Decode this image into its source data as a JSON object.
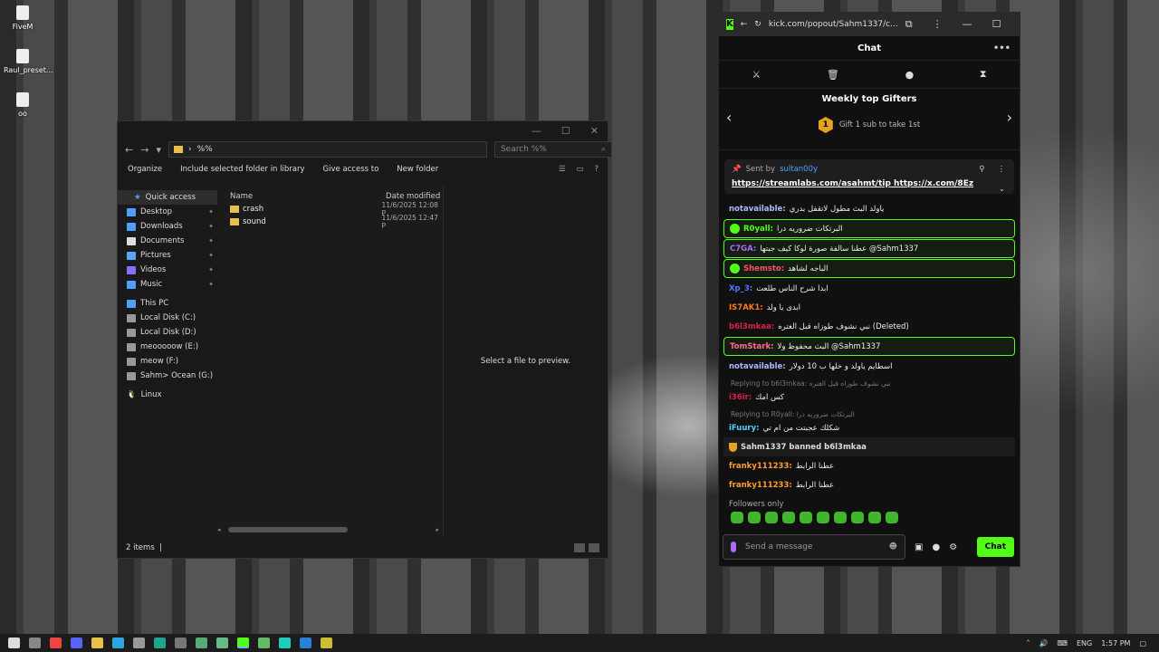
{
  "desktop": {
    "icons": [
      {
        "label": "FiveM"
      },
      {
        "label": "Raul_preset..."
      },
      {
        "label": "oo"
      }
    ]
  },
  "explorer": {
    "address": "%%",
    "search_placeholder": "Search %%",
    "toolbar": {
      "organize": "Organize",
      "include": "Include selected folder in library",
      "give_access": "Give access to",
      "new_folder": "New folder"
    },
    "nav": {
      "quick_access": "Quick access",
      "desktop": "Desktop",
      "downloads": "Downloads",
      "documents": "Documents",
      "pictures": "Pictures",
      "videos": "Videos",
      "music": "Music",
      "this_pc": "This PC",
      "c": "Local Disk (C:)",
      "d": "Local Disk (D:)",
      "e": "meooooow (E:)",
      "f": "meow (F:)",
      "g": "Sahm> Ocean (G:)",
      "linux": "Linux"
    },
    "columns": {
      "name": "Name",
      "date": "Date modified"
    },
    "files": [
      {
        "name": "crash",
        "date": "11/6/2025 12:08 P"
      },
      {
        "name": "sound",
        "date": "11/6/2025 12:47 P"
      }
    ],
    "preview": "Select a file to preview.",
    "status": "2 items"
  },
  "kick": {
    "url": "kick.com/popout/Sahm1337/c...",
    "title": "Chat",
    "gifters_title": "Weekly top Gifters",
    "gifters_rank": "1",
    "gifters_sub": "Gift 1 sub to take 1st",
    "pinned": {
      "sent_by": "Sent by",
      "user": "sultan00y",
      "links": "https://streamlabs.com/asahmt/tip https://x.com/8Ez"
    },
    "messages": [
      {
        "user": "notavailable:",
        "text": "ياولد البث مطول لاتقفل بدري",
        "color": "#aeb9ff",
        "hl": false
      },
      {
        "user": "R0yall:",
        "text": "البرتكات ضروريه درا",
        "color": "#53fc18",
        "hl": true
      },
      {
        "user": "C7GA:",
        "text": "عطنا سالفة صورة لوكا كيف جبتها @Sahm1337",
        "color": "#b069ff",
        "hl": true
      },
      {
        "user": "Shemsto:",
        "text": "الباجه لشاهد",
        "color": "#ff4f6f",
        "hl": true
      },
      {
        "user": "Xp_3:",
        "text": "ابدا شرح الناس طلعت",
        "color": "#4e7bff",
        "hl": false
      },
      {
        "user": "IS7AK1:",
        "text": "ابدى يا ولد",
        "color": "#ff7a1a",
        "hl": false
      },
      {
        "user": "b6l3mkaa:",
        "text": "نبي نشوف طوزاه قبل الغتره (Deleted)",
        "color": "#d8214a",
        "hl": false
      },
      {
        "user": "TomStark:",
        "text": "البث محفوظ ولا @Sahm1337",
        "color": "#ff6b8a",
        "hl": true
      },
      {
        "user": "notavailable:",
        "text": "اسطايم ياولد و خلها ب 10 دولار",
        "color": "#aeb9ff",
        "hl": false
      }
    ],
    "replies": [
      {
        "reply": "Replying to b6l3mkaa: نبي نشوف طوزاه قبل الغتره",
        "user": "i36ir:",
        "text": "كس امك",
        "color": "#d8214a"
      },
      {
        "reply": "Replying to R0yall: البرتكات ضروريه درا",
        "user": "iFuury:",
        "text": "شكلك عجبتت من ام تي",
        "color": "#4fd1ff"
      }
    ],
    "system": "Sahm1337 banned b6l3mkaa",
    "tail": [
      {
        "user": "franky111233:",
        "text": "عطنا الرابط",
        "color": "#ff9d2f"
      },
      {
        "user": "franky111233:",
        "text": "عطنا الرابط",
        "color": "#ff9d2f"
      }
    ],
    "followers_only": "Followers only",
    "input_placeholder": "Send a message",
    "send": "Chat"
  },
  "taskbar": {
    "lang": "ENG",
    "time": "1:57 PM"
  }
}
